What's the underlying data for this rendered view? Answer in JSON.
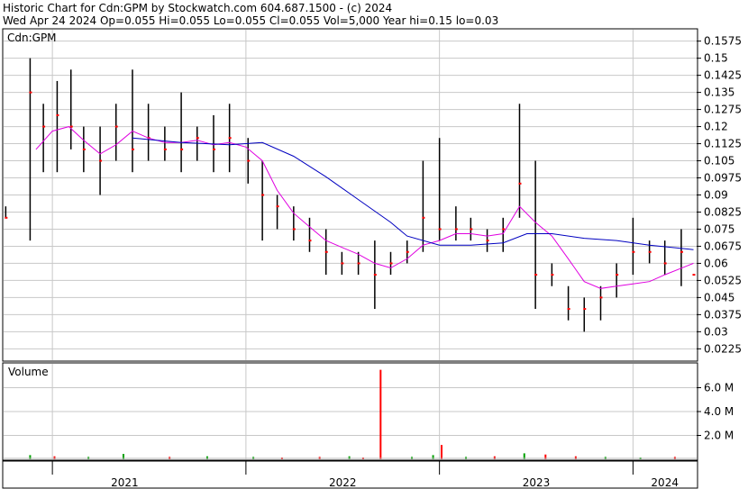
{
  "header": {
    "line1": "Historic Chart for Cdn:GPM by Stockwatch.com 604.687.1500 - (c) 2024",
    "line2": "Wed Apr 24 2024  Op=0.055  Hi=0.055  Lo=0.055  Cl=0.055  Vol=5,000  Year hi=0.15  lo=0.03"
  },
  "colors": {
    "price_bar": "#000000",
    "close_dot": "#ff0000",
    "ma_short": "#e000e0",
    "ma_long": "#0000c0",
    "vol_down": "#ff0000",
    "vol_up": "#00a000",
    "grid": "#c8c8c8"
  },
  "chart_data": [
    {
      "type": "line",
      "label": "Cdn:GPM",
      "y_ticks": [
        "0.1575",
        "0.15",
        "0.1425",
        "0.135",
        "0.1275",
        "0.12",
        "0.1125",
        "0.105",
        "0.0975",
        "0.09",
        "0.0825",
        "0.075",
        "0.0675",
        "0.06",
        "0.0525",
        "0.045",
        "0.0375",
        "0.03",
        "0.0225"
      ],
      "ylim": [
        0.0175,
        0.1625
      ],
      "x_labels": [
        "2021",
        "2022",
        "2023",
        "2024"
      ],
      "xlim": [
        "2020-10-01",
        "2024-04-30"
      ],
      "grid": true,
      "series": [
        {
          "values": [
            {
              "x": "2020-10-05",
              "high": 0.085,
              "low": 0.08,
              "close": 0.08
            },
            {
              "x": "2020-11-20",
              "high": 0.15,
              "low": 0.07,
              "close": 0.135
            },
            {
              "x": "2020-12-15",
              "high": 0.13,
              "low": 0.1,
              "close": 0.12
            },
            {
              "x": "2021-01-10",
              "high": 0.14,
              "low": 0.1,
              "close": 0.125
            },
            {
              "x": "2021-02-05",
              "high": 0.145,
              "low": 0.11,
              "close": 0.12
            },
            {
              "x": "2021-03-01",
              "high": 0.12,
              "low": 0.1,
              "close": 0.11
            },
            {
              "x": "2021-04-01",
              "high": 0.12,
              "low": 0.09,
              "close": 0.105
            },
            {
              "x": "2021-05-01",
              "high": 0.13,
              "low": 0.105,
              "close": 0.12
            },
            {
              "x": "2021-06-01",
              "high": 0.145,
              "low": 0.1,
              "close": 0.11
            },
            {
              "x": "2021-07-01",
              "high": 0.13,
              "low": 0.105,
              "close": 0.115
            },
            {
              "x": "2021-08-01",
              "high": 0.12,
              "low": 0.105,
              "close": 0.11
            },
            {
              "x": "2021-09-01",
              "high": 0.135,
              "low": 0.1,
              "close": 0.11
            },
            {
              "x": "2021-10-01",
              "high": 0.12,
              "low": 0.105,
              "close": 0.115
            },
            {
              "x": "2021-11-01",
              "high": 0.125,
              "low": 0.1,
              "close": 0.11
            },
            {
              "x": "2021-12-01",
              "high": 0.13,
              "low": 0.1,
              "close": 0.115
            },
            {
              "x": "2022-01-05",
              "high": 0.115,
              "low": 0.095,
              "close": 0.105
            },
            {
              "x": "2022-02-01",
              "high": 0.105,
              "low": 0.07,
              "close": 0.09
            },
            {
              "x": "2022-03-01",
              "high": 0.09,
              "low": 0.075,
              "close": 0.085
            },
            {
              "x": "2022-04-01",
              "high": 0.085,
              "low": 0.07,
              "close": 0.075
            },
            {
              "x": "2022-05-01",
              "high": 0.08,
              "low": 0.065,
              "close": 0.07
            },
            {
              "x": "2022-06-01",
              "high": 0.075,
              "low": 0.055,
              "close": 0.065
            },
            {
              "x": "2022-07-01",
              "high": 0.065,
              "low": 0.055,
              "close": 0.06
            },
            {
              "x": "2022-08-01",
              "high": 0.065,
              "low": 0.055,
              "close": 0.06
            },
            {
              "x": "2022-09-01",
              "high": 0.07,
              "low": 0.04,
              "close": 0.055
            },
            {
              "x": "2022-10-01",
              "high": 0.065,
              "low": 0.055,
              "close": 0.06
            },
            {
              "x": "2022-11-01",
              "high": 0.07,
              "low": 0.06,
              "close": 0.065
            },
            {
              "x": "2022-12-01",
              "high": 0.105,
              "low": 0.065,
              "close": 0.08
            },
            {
              "x": "2023-01-01",
              "high": 0.115,
              "low": 0.07,
              "close": 0.075
            },
            {
              "x": "2023-02-01",
              "high": 0.085,
              "low": 0.07,
              "close": 0.075
            },
            {
              "x": "2023-03-01",
              "high": 0.08,
              "low": 0.07,
              "close": 0.075
            },
            {
              "x": "2023-04-01",
              "high": 0.075,
              "low": 0.065,
              "close": 0.07
            },
            {
              "x": "2023-05-01",
              "high": 0.08,
              "low": 0.065,
              "close": 0.075
            },
            {
              "x": "2023-06-01",
              "high": 0.13,
              "low": 0.08,
              "close": 0.095
            },
            {
              "x": "2023-07-01",
              "high": 0.105,
              "low": 0.04,
              "close": 0.055
            },
            {
              "x": "2023-08-01",
              "high": 0.06,
              "low": 0.05,
              "close": 0.055
            },
            {
              "x": "2023-09-01",
              "high": 0.05,
              "low": 0.035,
              "close": 0.04
            },
            {
              "x": "2023-10-01",
              "high": 0.045,
              "low": 0.03,
              "close": 0.04
            },
            {
              "x": "2023-11-01",
              "high": 0.05,
              "low": 0.035,
              "close": 0.045
            },
            {
              "x": "2023-12-01",
              "high": 0.06,
              "low": 0.045,
              "close": 0.055
            },
            {
              "x": "2024-01-01",
              "high": 0.08,
              "low": 0.055,
              "close": 0.065
            },
            {
              "x": "2024-02-01",
              "high": 0.07,
              "low": 0.06,
              "close": 0.065
            },
            {
              "x": "2024-03-01",
              "high": 0.07,
              "low": 0.055,
              "close": 0.06
            },
            {
              "x": "2024-04-01",
              "high": 0.075,
              "low": 0.05,
              "close": 0.065
            },
            {
              "x": "2024-04-24",
              "high": 0.055,
              "low": 0.055,
              "close": 0.055
            }
          ]
        },
        {
          "values": [
            {
              "x": "2020-12-01",
              "y": 0.11
            },
            {
              "x": "2021-01-01",
              "y": 0.118
            },
            {
              "x": "2021-02-01",
              "y": 0.12
            },
            {
              "x": "2021-03-01",
              "y": 0.114
            },
            {
              "x": "2021-04-01",
              "y": 0.108
            },
            {
              "x": "2021-05-01",
              "y": 0.112
            },
            {
              "x": "2021-06-01",
              "y": 0.118
            },
            {
              "x": "2021-07-01",
              "y": 0.115
            },
            {
              "x": "2021-08-01",
              "y": 0.113
            },
            {
              "x": "2021-09-01",
              "y": 0.113
            },
            {
              "x": "2021-10-01",
              "y": 0.114
            },
            {
              "x": "2021-11-01",
              "y": 0.112
            },
            {
              "x": "2021-12-01",
              "y": 0.113
            },
            {
              "x": "2022-01-01",
              "y": 0.111
            },
            {
              "x": "2022-02-01",
              "y": 0.105
            },
            {
              "x": "2022-03-01",
              "y": 0.092
            },
            {
              "x": "2022-04-01",
              "y": 0.082
            },
            {
              "x": "2022-05-01",
              "y": 0.076
            },
            {
              "x": "2022-06-01",
              "y": 0.07
            },
            {
              "x": "2022-07-01",
              "y": 0.067
            },
            {
              "x": "2022-08-01",
              "y": 0.064
            },
            {
              "x": "2022-09-01",
              "y": 0.06
            },
            {
              "x": "2022-10-01",
              "y": 0.058
            },
            {
              "x": "2022-11-01",
              "y": 0.062
            },
            {
              "x": "2022-12-01",
              "y": 0.068
            },
            {
              "x": "2023-01-01",
              "y": 0.07
            },
            {
              "x": "2023-02-01",
              "y": 0.073
            },
            {
              "x": "2023-03-01",
              "y": 0.073
            },
            {
              "x": "2023-04-01",
              "y": 0.072
            },
            {
              "x": "2023-05-01",
              "y": 0.073
            },
            {
              "x": "2023-06-01",
              "y": 0.085
            },
            {
              "x": "2023-07-01",
              "y": 0.078
            },
            {
              "x": "2023-08-01",
              "y": 0.072
            },
            {
              "x": "2023-09-01",
              "y": 0.062
            },
            {
              "x": "2023-10-01",
              "y": 0.052
            },
            {
              "x": "2023-11-01",
              "y": 0.049
            },
            {
              "x": "2023-12-01",
              "y": 0.05
            },
            {
              "x": "2024-01-01",
              "y": 0.051
            },
            {
              "x": "2024-02-01",
              "y": 0.052
            },
            {
              "x": "2024-03-01",
              "y": 0.055
            },
            {
              "x": "2024-04-24",
              "y": 0.06
            }
          ]
        },
        {
          "values": [
            {
              "x": "2021-06-01",
              "y": 0.115
            },
            {
              "x": "2021-09-01",
              "y": 0.113
            },
            {
              "x": "2021-12-01",
              "y": 0.112
            },
            {
              "x": "2022-02-01",
              "y": 0.113
            },
            {
              "x": "2022-04-01",
              "y": 0.107
            },
            {
              "x": "2022-06-01",
              "y": 0.098
            },
            {
              "x": "2022-08-01",
              "y": 0.088
            },
            {
              "x": "2022-10-01",
              "y": 0.078
            },
            {
              "x": "2022-11-01",
              "y": 0.072
            },
            {
              "x": "2023-01-01",
              "y": 0.068
            },
            {
              "x": "2023-03-01",
              "y": 0.068
            },
            {
              "x": "2023-05-01",
              "y": 0.069
            },
            {
              "x": "2023-06-15",
              "y": 0.073
            },
            {
              "x": "2023-08-01",
              "y": 0.073
            },
            {
              "x": "2023-10-01",
              "y": 0.071
            },
            {
              "x": "2023-12-01",
              "y": 0.07
            },
            {
              "x": "2024-02-01",
              "y": 0.068
            },
            {
              "x": "2024-04-24",
              "y": 0.066
            }
          ]
        }
      ]
    },
    {
      "type": "bar",
      "title": "Volume",
      "y_ticks": [
        "6.0 M",
        "4.0 M",
        "2.0 M"
      ],
      "ylim": [
        0,
        8000000
      ],
      "x_labels": [
        "2021",
        "2022",
        "2023",
        "2024"
      ],
      "series": [
        {
          "values": [
            {
              "x": "2020-11-20",
              "y": 350000,
              "dir": "up"
            },
            {
              "x": "2021-01-05",
              "y": 250000,
              "dir": "down"
            },
            {
              "x": "2021-03-10",
              "y": 200000,
              "dir": "up"
            },
            {
              "x": "2021-05-15",
              "y": 450000,
              "dir": "up"
            },
            {
              "x": "2021-08-10",
              "y": 200000,
              "dir": "down"
            },
            {
              "x": "2021-10-20",
              "y": 250000,
              "dir": "up"
            },
            {
              "x": "2022-01-15",
              "y": 200000,
              "dir": "up"
            },
            {
              "x": "2022-03-10",
              "y": 150000,
              "dir": "down"
            },
            {
              "x": "2022-05-20",
              "y": 200000,
              "dir": "down"
            },
            {
              "x": "2022-07-15",
              "y": 250000,
              "dir": "up"
            },
            {
              "x": "2022-08-10",
              "y": 150000,
              "dir": "down"
            },
            {
              "x": "2022-09-12",
              "y": 7500000,
              "dir": "down"
            },
            {
              "x": "2022-11-10",
              "y": 200000,
              "dir": "up"
            },
            {
              "x": "2022-12-20",
              "y": 350000,
              "dir": "up"
            },
            {
              "x": "2023-01-05",
              "y": 1200000,
              "dir": "down"
            },
            {
              "x": "2023-02-20",
              "y": 200000,
              "dir": "up"
            },
            {
              "x": "2023-04-15",
              "y": 250000,
              "dir": "down"
            },
            {
              "x": "2023-06-10",
              "y": 500000,
              "dir": "up"
            },
            {
              "x": "2023-07-20",
              "y": 400000,
              "dir": "down"
            },
            {
              "x": "2023-09-15",
              "y": 250000,
              "dir": "down"
            },
            {
              "x": "2023-11-10",
              "y": 200000,
              "dir": "up"
            },
            {
              "x": "2024-01-15",
              "y": 150000,
              "dir": "up"
            },
            {
              "x": "2024-03-20",
              "y": 200000,
              "dir": "down"
            }
          ]
        }
      ]
    }
  ]
}
